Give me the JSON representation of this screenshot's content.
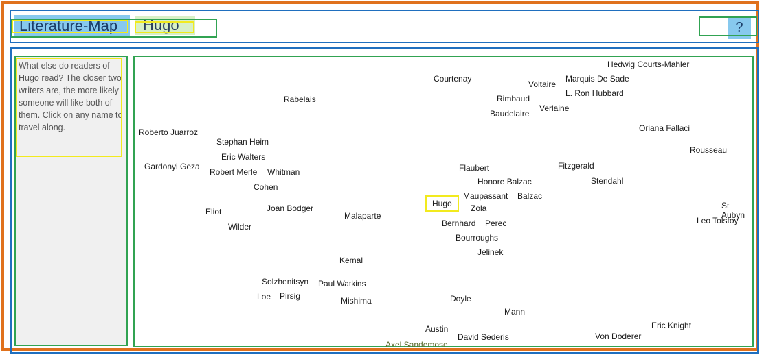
{
  "app": {
    "brand": "Literature-Map",
    "current_author": "Hugo",
    "help_label": "?"
  },
  "sidebar": {
    "description": "What else do readers of Hugo read? The closer two writers are, the more likely someone will like both of them. Click on any name to travel along."
  },
  "map": {
    "authors": [
      {
        "name": "Hedwig Courts-Mahler",
        "key": "hedwig-courts-mahler"
      },
      {
        "name": "Courtenay",
        "key": "courtenay"
      },
      {
        "name": "Marquis De Sade",
        "key": "marquis-de-sade"
      },
      {
        "name": "Voltaire",
        "key": "voltaire"
      },
      {
        "name": "Rabelais",
        "key": "rabelais"
      },
      {
        "name": "L. Ron Hubbard",
        "key": "l-ron-hubbard"
      },
      {
        "name": "Rimbaud",
        "key": "rimbaud"
      },
      {
        "name": "Verlaine",
        "key": "verlaine"
      },
      {
        "name": "Baudelaire",
        "key": "baudelaire"
      },
      {
        "name": "Oriana Fallaci",
        "key": "oriana-fallaci"
      },
      {
        "name": "Roberto Juarroz",
        "key": "roberto-juarroz"
      },
      {
        "name": "Stephan Heim",
        "key": "stephan-heim"
      },
      {
        "name": "Rousseau",
        "key": "rousseau"
      },
      {
        "name": "Eric Walters",
        "key": "eric-walters"
      },
      {
        "name": "Gardonyi Geza",
        "key": "gardonyi-geza"
      },
      {
        "name": "Fitzgerald",
        "key": "fitzgerald"
      },
      {
        "name": "Flaubert",
        "key": "flaubert"
      },
      {
        "name": "Robert Merle",
        "key": "robert-merle"
      },
      {
        "name": "Whitman",
        "key": "whitman"
      },
      {
        "name": "Honore Balzac",
        "key": "honore-balzac"
      },
      {
        "name": "Stendahl",
        "key": "stendahl"
      },
      {
        "name": "Cohen",
        "key": "cohen"
      },
      {
        "name": "Maupassant",
        "key": "maupassant"
      },
      {
        "name": "Balzac",
        "key": "balzac"
      },
      {
        "name": "Hugo",
        "key": "hugo"
      },
      {
        "name": "St",
        "key": "st"
      },
      {
        "name": "Eliot",
        "key": "eliot"
      },
      {
        "name": "Joan Bodger",
        "key": "joan-bodger"
      },
      {
        "name": "Zola",
        "key": "zola"
      },
      {
        "name": "Aubyn",
        "key": "aubyn"
      },
      {
        "name": "Malaparte",
        "key": "malaparte"
      },
      {
        "name": "Leo Tolstoy",
        "key": "leo-tolstoy"
      },
      {
        "name": "Wilder",
        "key": "wilder"
      },
      {
        "name": "Bernhard",
        "key": "bernhard"
      },
      {
        "name": "Perec",
        "key": "perec"
      },
      {
        "name": "Bourroughs",
        "key": "bourroughs"
      },
      {
        "name": "Jelinek",
        "key": "jelinek"
      },
      {
        "name": "Kemal",
        "key": "kemal"
      },
      {
        "name": "Solzhenitsyn",
        "key": "solzhenitsyn"
      },
      {
        "name": "Paul Watkins",
        "key": "paul-watkins"
      },
      {
        "name": "Loe",
        "key": "loe"
      },
      {
        "name": "Pirsig",
        "key": "pirsig"
      },
      {
        "name": "Mishima",
        "key": "mishima"
      },
      {
        "name": "Doyle",
        "key": "doyle"
      },
      {
        "name": "Mann",
        "key": "mann"
      },
      {
        "name": "Eric Knight",
        "key": "eric-knight"
      },
      {
        "name": "Austin",
        "key": "austin"
      },
      {
        "name": "David Sederis",
        "key": "david-sederis"
      },
      {
        "name": "Von Doderer",
        "key": "von-doderer"
      },
      {
        "name": "Axel Sandemose",
        "key": "axel-sandemose"
      }
    ]
  },
  "colors": {
    "orange_frame": "#e0711c",
    "blue_frame": "#1f6fbf",
    "green_frame": "#31a352",
    "yellow_highlight": "#f2ea1e",
    "logo_bg": "#87c9ee"
  }
}
